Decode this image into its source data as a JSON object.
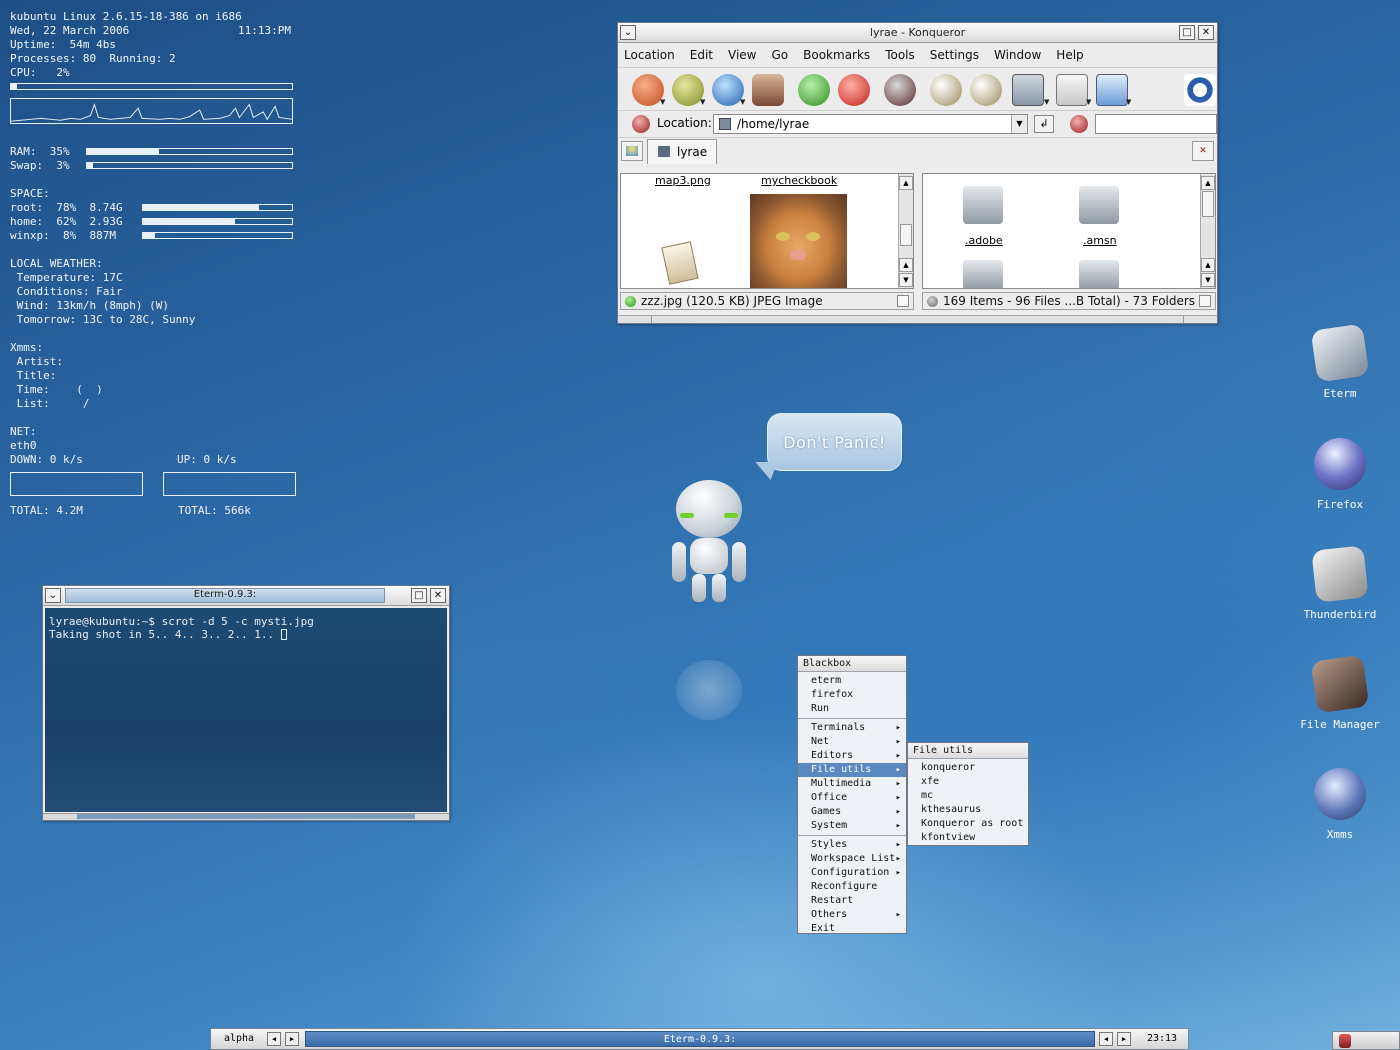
{
  "conky": {
    "line1": "kubuntu Linux 2.6.15-18-386 on i686",
    "date": "Wed, 22 March 2006",
    "time": "11:13:PM",
    "uptime": "Uptime:  54m 4bs",
    "processes": "Processes: 80  Running: 2",
    "cpu": "CPU:   2%",
    "cpu_percent": 2,
    "ram": "RAM:  35%",
    "ram_percent": 35,
    "swap": "Swap:  3%",
    "swap_percent": 3,
    "space_label": "SPACE:",
    "root": "root:  78%  8.74G",
    "root_percent": 78,
    "home": "home:  62%  2.93G",
    "home_percent": 62,
    "winxp": "winxp:  8%  887M",
    "winxp_percent": 8,
    "weather_label": "LOCAL WEATHER:",
    "temperature": " Temperature: 17C",
    "conditions": " Conditions: Fair",
    "wind": " Wind: 13km/h (8mph) (W)",
    "tomorrow": " Tomorrow: 13C to 28C, Sunny",
    "xmms_label": "Xmms:",
    "artist": " Artist:",
    "title": " Title:",
    "xtime": " Time:    (  )",
    "list": " List:     /",
    "net_label": "NET:",
    "iface": "eth0",
    "down": "DOWN: 0 k/s",
    "up": "UP: 0 k/s",
    "total_down": "TOTAL: 4.2M",
    "total_up": "TOTAL: 566k"
  },
  "konqueror": {
    "title": "lyrae - Konqueror",
    "menu": [
      "Location",
      "Edit",
      "View",
      "Go",
      "Bookmarks",
      "Tools",
      "Settings",
      "Window",
      "Help"
    ],
    "location_label": "Location:",
    "location_value": "/home/lyrae",
    "tab_label": "lyrae",
    "left_files": [
      "map3.png",
      "mycheckbook"
    ],
    "right_files": [
      ".adobe",
      ".amsn"
    ],
    "status_left": "zzz.jpg (120.5 KB)  JPEG Image",
    "status_right": "169 Items - 96 Files ...B Total) - 73 Folders"
  },
  "eterm": {
    "title": "Eterm-0.9.3:",
    "line1": "lyrae@kubuntu:~$ scrot -d 5 -c mysti.jpg",
    "line2": "Taking shot in 5.. 4.. 3.. 2.. 1.. "
  },
  "bubble": {
    "text": "Don't  Panic!"
  },
  "desktop_icons": [
    "Eterm",
    "Firefox",
    "Thunderbird",
    "File Manager",
    "Xmms"
  ],
  "bbmenu": {
    "title": "Blackbox",
    "group1": [
      "eterm",
      "firefox",
      "Run"
    ],
    "group2": [
      "Terminals",
      "Net",
      "Editors",
      "File utils",
      "Multimedia",
      "Office",
      "Games",
      "System"
    ],
    "group3": [
      "Styles",
      "Workspace List",
      "Configuration",
      "Reconfigure",
      "Restart",
      "Others",
      "Exit"
    ]
  },
  "fileutils": {
    "title": "File utils",
    "items": [
      "konqueror",
      "xfe",
      "mc",
      "kthesaurus",
      "Konqueror as root",
      "kfontview"
    ]
  },
  "taskbar": {
    "workspace": "alpha",
    "window": "Eterm-0.9.3:",
    "clock": "23:13"
  }
}
